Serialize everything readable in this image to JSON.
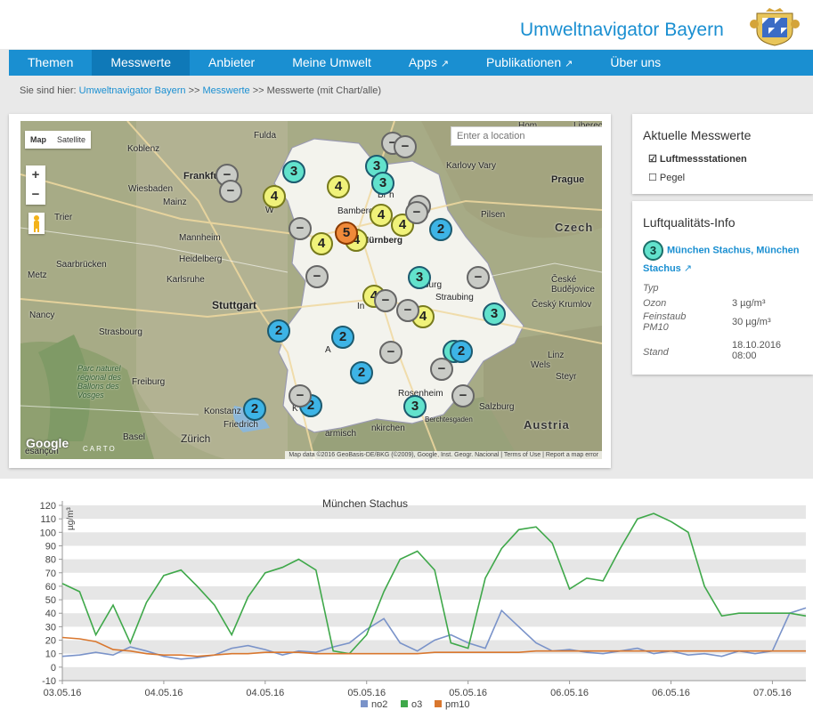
{
  "header": {
    "site_title": "Umweltnavigator Bayern"
  },
  "nav": {
    "items": [
      {
        "label": "Themen",
        "external": false,
        "active": false
      },
      {
        "label": "Messwerte",
        "external": false,
        "active": true
      },
      {
        "label": "Anbieter",
        "external": false,
        "active": false
      },
      {
        "label": "Meine Umwelt",
        "external": false,
        "active": false
      },
      {
        "label": "Apps",
        "external": true,
        "active": false
      },
      {
        "label": "Publikationen",
        "external": true,
        "active": false
      },
      {
        "label": "Über uns",
        "external": false,
        "active": false
      }
    ],
    "external_icon": "external-link-icon"
  },
  "breadcrumb": {
    "prefix": "Sie sind hier:",
    "link1": "Umweltnavigator Bayern",
    "sep": ">>",
    "link2": "Messwerte",
    "current": "Messwerte (mit Chart/alle)"
  },
  "map": {
    "map_type": {
      "map": "Map",
      "satellite": "Satellite"
    },
    "zoom": {
      "plus": "+",
      "minus": "−"
    },
    "search_placeholder": "Enter a location",
    "google": "Google",
    "carto": "CARTO",
    "attribution": "Map data ©2016 GeoBasis-DE/BKG (©2009), Google, Inst. Geogr. Nacional | Terms of Use | Report a map error",
    "labels": {
      "fulda": "Fulda",
      "koblenz": "Koblenz",
      "frankfurt": "Frankfurt",
      "wiesbaden": "Wiesbaden",
      "mainz": "Mainz",
      "trier": "Trier",
      "mannheim": "Mannheim",
      "heidelberg": "Heidelberg",
      "saarbrucken": "Saarbrücken",
      "metz": "Metz",
      "karlsruhe": "Karlsruhe",
      "stuttgart": "Stuttgart",
      "nancy": "Nancy",
      "strasbourg": "Strasbourg",
      "freiburg": "Freiburg",
      "vosges": "Parc naturel régional des Ballons des Vosges",
      "konstanz": "Konstanz",
      "friedrichshafen": "Friedrich",
      "basel": "Basel",
      "zurich": "Zürich",
      "besancon": "esançon",
      "karlovy": "Karlovy Vary",
      "prague": "Prague",
      "pilsen": "Pilsen",
      "czech": "Czech",
      "ceske": "České Budějovice",
      "cesky": "Český Krumlov",
      "linz": "Linz",
      "wels": "Wels",
      "steyr": "Steyr",
      "salzburg": "Salzburg",
      "rosenheim": "Rosenheim",
      "austria": "Austria",
      "straubing": "Straubing",
      "nurnberg": "Nürnberg",
      "bamberg": "Bamberg",
      "wurzburg": "W",
      "ingolstadt": "In",
      "augsburg": "A",
      "regensburg": "burg",
      "kempten": "K",
      "garmisch": "armisch",
      "berchtesgaden": "Berchtesgaden",
      "kirchen": "nkirchen",
      "liberec": "Liberec",
      "hom": "Hom",
      "lie": "Lie",
      "br": "Br",
      "ch": "h"
    },
    "markers": [
      {
        "label": "3",
        "level": 3
      },
      {
        "label": "3",
        "level": 3
      },
      {
        "label": "3",
        "level": 3
      },
      {
        "label": "3",
        "level": 3
      },
      {
        "label": "3",
        "level": 3
      },
      {
        "label": "3",
        "level": 3
      },
      {
        "label": "3",
        "level": 3
      },
      {
        "label": "4",
        "level": 4
      },
      {
        "label": "4",
        "level": 4
      },
      {
        "label": "4",
        "level": 4
      },
      {
        "label": "4",
        "level": 4
      },
      {
        "label": "4",
        "level": 4
      },
      {
        "label": "4",
        "level": 4
      },
      {
        "label": "4",
        "level": 4
      },
      {
        "label": "4",
        "level": 4
      },
      {
        "label": "5",
        "level": 5
      },
      {
        "label": "2",
        "level": 2
      },
      {
        "label": "2",
        "level": 2
      },
      {
        "label": "2",
        "level": 2
      },
      {
        "label": "2",
        "level": 2
      },
      {
        "label": "2",
        "level": 2
      },
      {
        "label": "2",
        "level": 2
      },
      {
        "label": "2",
        "level": 2
      },
      {
        "label": "−",
        "level": 0
      },
      {
        "label": "−",
        "level": 0
      },
      {
        "label": "−",
        "level": 0
      },
      {
        "label": "−",
        "level": 0
      },
      {
        "label": "−",
        "level": 0
      },
      {
        "label": "−",
        "level": 0
      },
      {
        "label": "−",
        "level": 0
      },
      {
        "label": "−",
        "level": 0
      },
      {
        "label": "−",
        "level": 0
      },
      {
        "label": "−",
        "level": 0
      },
      {
        "label": "−",
        "level": 0
      },
      {
        "label": "−",
        "level": 0
      },
      {
        "label": "−",
        "level": 0
      },
      {
        "label": "−",
        "level": 0
      },
      {
        "label": "−",
        "level": 0
      }
    ],
    "level_colors": {
      "0": "#c9cbc6",
      "2": "#3db4e6",
      "3": "#62e2cc",
      "4": "#f0f27a",
      "5": "#f08a3a"
    }
  },
  "current_values": {
    "title": "Aktuelle Messwerte",
    "opt1": "☑ Luftmessstationen",
    "opt2": "☐ Pegel"
  },
  "air_quality": {
    "title": "Luftqualitäts-Info",
    "station_index": "3",
    "station_name": "München Stachus, München Stachus",
    "rows": [
      {
        "key": "Typ",
        "value": ""
      },
      {
        "key": "Ozon",
        "value": "3 µg/m³"
      },
      {
        "key": "Feinstaub PM10",
        "value": "30 µg/m³"
      },
      {
        "key": "Stand",
        "value": "18.10.2016 08:00"
      }
    ]
  },
  "chart_data": {
    "type": "line",
    "title": "München Stachus",
    "ylabel": "µg/m³",
    "ylim": [
      -10,
      120
    ],
    "yticks": [
      -10,
      0,
      10,
      20,
      30,
      40,
      50,
      60,
      70,
      80,
      90,
      100,
      110,
      120
    ],
    "xticks": [
      "03.05.16",
      "04.05.16",
      "04.05.16",
      "05.05.16",
      "05.05.16",
      "06.05.16",
      "06.05.16",
      "07.05.16"
    ],
    "xtick_days": [
      0,
      1,
      2,
      3,
      4,
      5,
      6,
      7
    ],
    "x_days": [
      0,
      0.17,
      0.33,
      0.5,
      0.67,
      0.83,
      1.0,
      1.17,
      1.33,
      1.5,
      1.67,
      1.83,
      2.0,
      2.17,
      2.33,
      2.5,
      2.67,
      2.83,
      3.0,
      3.17,
      3.33,
      3.5,
      3.67,
      3.83,
      4.0,
      4.17,
      4.33,
      4.5,
      4.67,
      4.83,
      5.0,
      5.17,
      5.33,
      5.5,
      5.67,
      5.83,
      6.0,
      6.17,
      6.33,
      6.5,
      6.67,
      6.83,
      7.0,
      7.17,
      7.33
    ],
    "series": [
      {
        "name": "no2",
        "color": "#7a93c9",
        "values": [
          8,
          9,
          11,
          9,
          15,
          12,
          8,
          6,
          7,
          9,
          14,
          16,
          13,
          9,
          12,
          11,
          15,
          18,
          28,
          36,
          18,
          12,
          20,
          24,
          18,
          14,
          42,
          30,
          18,
          12,
          13,
          11,
          10,
          12,
          14,
          10,
          12,
          9,
          10,
          8,
          12,
          10,
          12,
          40,
          44
        ]
      },
      {
        "name": "o3",
        "color": "#3fa84a",
        "values": [
          62,
          56,
          24,
          46,
          18,
          48,
          68,
          72,
          60,
          46,
          24,
          52,
          70,
          74,
          80,
          72,
          12,
          10,
          24,
          56,
          80,
          86,
          72,
          18,
          14,
          66,
          88,
          102,
          104,
          92,
          58,
          66,
          64,
          88,
          110,
          114,
          108,
          100,
          60,
          38,
          40,
          40,
          40,
          40,
          38
        ]
      },
      {
        "name": "pm10",
        "color": "#d9772e",
        "values": [
          22,
          21,
          19,
          13,
          12,
          10,
          9,
          9,
          8,
          9,
          10,
          10,
          11,
          11,
          11,
          10,
          10,
          10,
          10,
          10,
          10,
          10,
          11,
          11,
          11,
          11,
          11,
          11,
          12,
          12,
          12,
          12,
          12,
          12,
          12,
          12,
          12,
          12,
          12,
          12,
          12,
          12,
          12,
          12,
          12
        ]
      }
    ],
    "legend_position": "bottom",
    "grid": "horizontal bands"
  }
}
